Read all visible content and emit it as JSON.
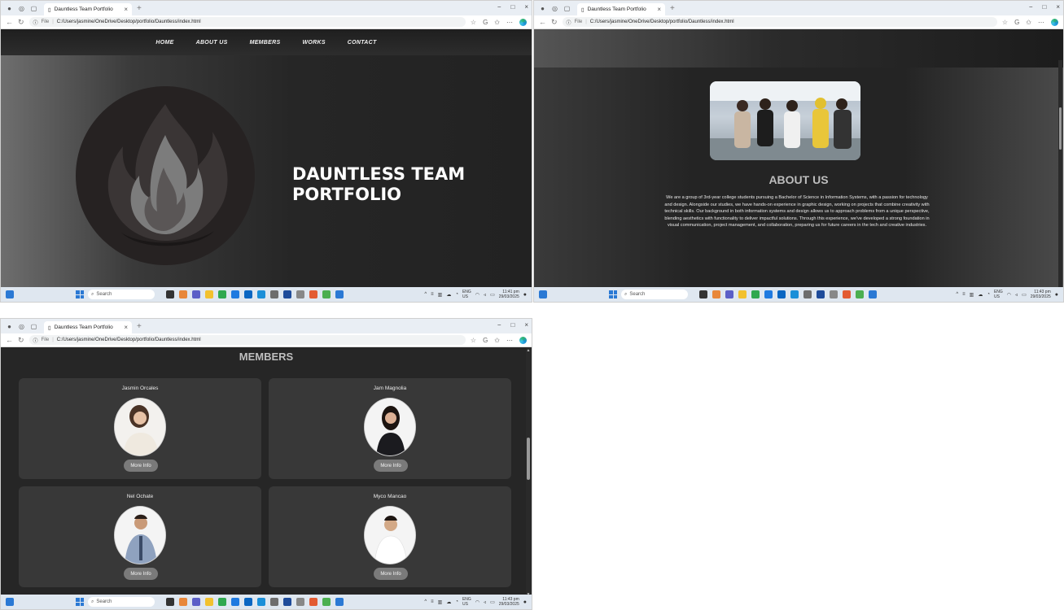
{
  "browser": {
    "tab_title": "Dauntless Team Portfolio",
    "tab_close": "×",
    "new_tab": "+",
    "file_label": "File",
    "url_sep": "|",
    "url": "C:/Users/jasmine/OneDrive/Desktop/portfolio/Dauntless/index.html",
    "win_controls": [
      "−",
      "□",
      "×"
    ]
  },
  "taskbar": {
    "search_placeholder": "Search",
    "lang_top": "ENG",
    "lang_bottom": "US",
    "windows": [
      {
        "time": "11:41 pm",
        "date": "29/03/2025"
      },
      {
        "time": "11:43 pm",
        "date": "29/03/2025"
      },
      {
        "time": "11:43 pm",
        "date": "29/03/2025"
      }
    ]
  },
  "site": {
    "nav": [
      "HOME",
      "ABOUT US",
      "MEMBERS",
      "WORKS",
      "CONTACT"
    ],
    "hero_title_line1": "DAUNTLESS TEAM",
    "hero_title_line2": "PORTFOLIO",
    "about_title": "ABOUT US",
    "about_text": "We are a group of 3rd-year college students pursuing a Bachelor of Science in Information Systems, with a passion for technology and design. Alongside our studies, we have hands-on experience in graphic design, working on projects that combine creativity with technical skills. Our background in both information systems and design allows us to approach problems from a unique perspective, blending aesthetics with functionality to deliver impactful solutions. Through this experience, we've developed a strong foundation in visual communication, project management, and collaboration, preparing us for future careers in the tech and creative industries.",
    "members_title": "MEMBERS",
    "members": [
      {
        "name": "Jasmin Orcales",
        "button": "More Info"
      },
      {
        "name": "Jam Magnolia",
        "button": "More Info"
      },
      {
        "name": "Nel Ochate",
        "button": "More Info"
      },
      {
        "name": "Myco Mancao",
        "button": "More Info"
      }
    ]
  },
  "colors": {
    "page_bg": "#262626",
    "card_bg": "#383838",
    "button_bg": "#7a7a7a",
    "heading_gray": "#bdbdbd",
    "edge_blue": "#2b79d4"
  }
}
